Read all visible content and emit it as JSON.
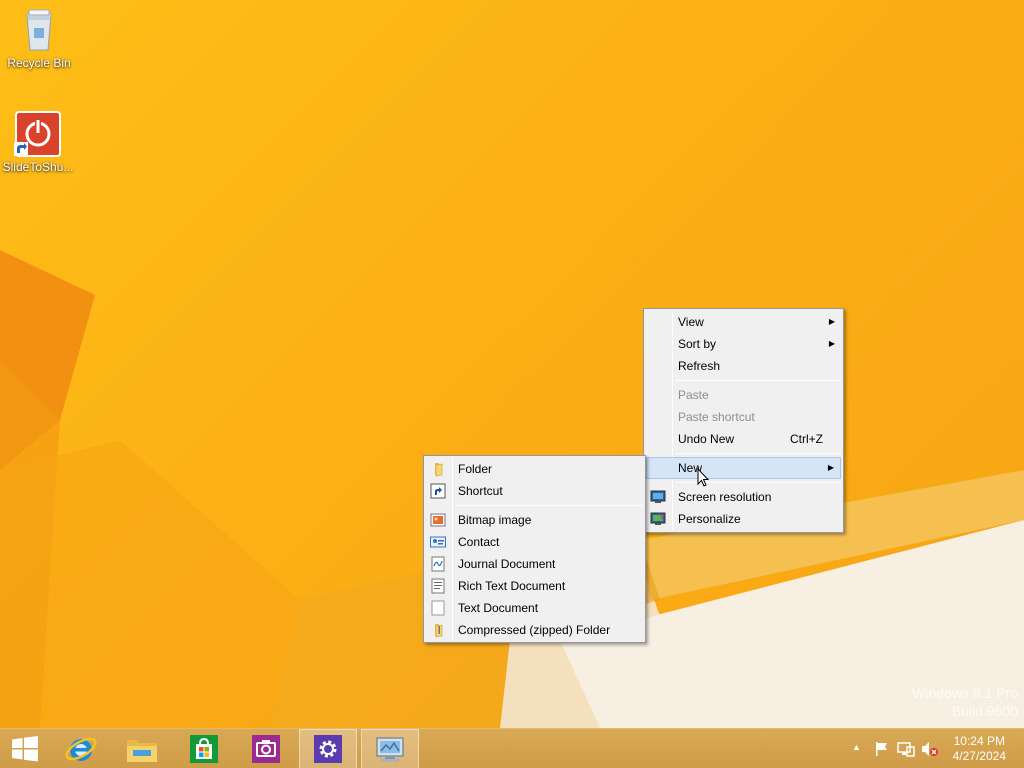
{
  "desktop": {
    "icons": [
      {
        "label": "Recycle Bin",
        "icon": "recycle-bin-icon"
      },
      {
        "label": "SlideToShu...",
        "icon": "slide-to-shutdown-icon"
      }
    ],
    "watermark": {
      "line1": "Windows 8.1 Pro",
      "line2": "Build 9600"
    }
  },
  "context_menu": {
    "items": [
      {
        "label": "View",
        "submenu": true
      },
      {
        "label": "Sort by",
        "submenu": true
      },
      {
        "label": "Refresh"
      },
      {
        "label": "Paste",
        "disabled": true
      },
      {
        "label": "Paste shortcut",
        "disabled": true
      },
      {
        "label": "Undo New",
        "accel": "Ctrl+Z"
      },
      {
        "label": "New",
        "submenu": true
      },
      {
        "label": "Screen resolution",
        "icon": "screen-resolution-icon"
      },
      {
        "label": "Personalize",
        "icon": "personalize-icon"
      }
    ]
  },
  "new_submenu": {
    "items": [
      {
        "label": "Folder",
        "icon": "folder-icon"
      },
      {
        "label": "Shortcut",
        "icon": "shortcut-icon"
      },
      {
        "label": "Bitmap image",
        "icon": "bitmap-icon"
      },
      {
        "label": "Contact",
        "icon": "contact-icon"
      },
      {
        "label": "Journal Document",
        "icon": "journal-icon"
      },
      {
        "label": "Rich Text Document",
        "icon": "rich-text-icon"
      },
      {
        "label": "Text Document",
        "icon": "text-document-icon"
      },
      {
        "label": "Compressed (zipped) Folder",
        "icon": "zip-folder-icon"
      }
    ]
  },
  "taskbar": {
    "buttons": [
      {
        "name": "start",
        "icon": "windows-logo-icon"
      },
      {
        "name": "internet-explorer",
        "icon": "internet-explorer-icon"
      },
      {
        "name": "file-explorer",
        "icon": "file-explorer-icon"
      },
      {
        "name": "store",
        "icon": "store-icon"
      },
      {
        "name": "camera",
        "icon": "camera-icon"
      },
      {
        "name": "settings",
        "icon": "gear-icon"
      },
      {
        "name": "control-panel",
        "icon": "control-panel-icon"
      }
    ],
    "clock": {
      "time": "10:24 PM",
      "date": "4/27/2024"
    }
  },
  "colors": {
    "wallpaper": "#fbb415",
    "menu_bg": "#f0f0f0",
    "hover": "#d5e5f5"
  }
}
